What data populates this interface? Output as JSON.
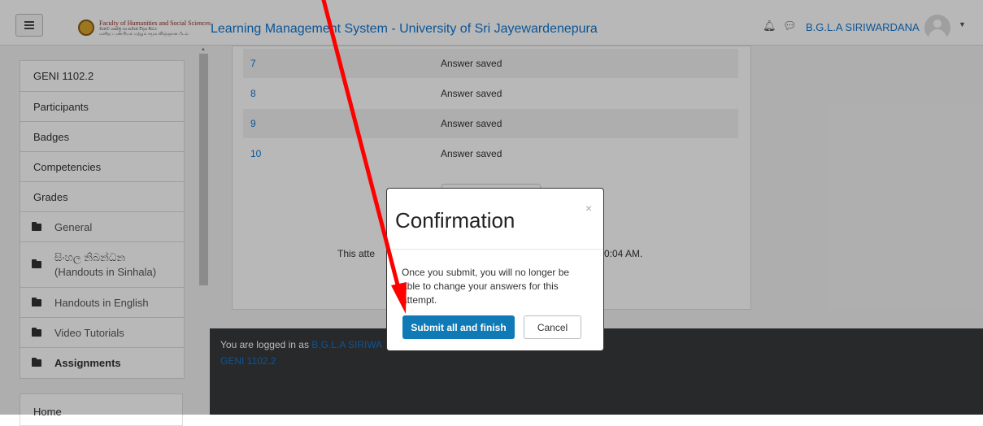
{
  "header": {
    "title": "Learning Management System - University of Sri Jayewardenepura",
    "logo_line1": "Faculty of Humanities and Social Sciences",
    "logo_line2": "මානව ශාස්ත්‍ර හා සමාජ විද්‍යා පීඨය",
    "logo_line3": "மனிதப் பண்பியல் மற்றும் சமூக விஞ்ஞான பீடம்",
    "user_name": "B.G.L.A SIRIWARDANA",
    "bell_icon": "bell-icon",
    "chat_icon": "chat-icon"
  },
  "sidebar": {
    "items": [
      {
        "label": "GENI 1102.2"
      },
      {
        "label": "Participants"
      },
      {
        "label": "Badges"
      },
      {
        "label": "Competencies"
      },
      {
        "label": "Grades"
      },
      {
        "label": "General"
      },
      {
        "label": "සිංහල නිබන්ධන"
      },
      {
        "label": "(Handouts in Sinhala)"
      },
      {
        "label": "Handouts in English"
      },
      {
        "label": "Video Tutorials"
      },
      {
        "label": "Assignments"
      }
    ],
    "home": "Home"
  },
  "summary": {
    "rows": [
      {
        "num": "7",
        "status": "Answer saved"
      },
      {
        "num": "8",
        "status": "Answer saved"
      },
      {
        "num": "9",
        "status": "Answer saved"
      },
      {
        "num": "10",
        "status": "Answer saved"
      }
    ],
    "attempt_text_left": "This atte",
    "attempt_text_right": "0:04 AM."
  },
  "footer": {
    "logged_prefix": "You are logged in as ",
    "logged_user": "B.G.L.A SIRIWA",
    "course": "GENI 1102.2"
  },
  "modal": {
    "title": "Confirmation",
    "close": "×",
    "body": "Once you submit, you will no longer be able to change your answers for this attempt.",
    "submit_label": "Submit all and finish",
    "cancel_label": "Cancel"
  },
  "annotation": {
    "arrow_color": "#ff0000"
  },
  "colors": {
    "link": "#1177d1",
    "primary": "#0f7ab5",
    "footer": "#373a3c"
  }
}
